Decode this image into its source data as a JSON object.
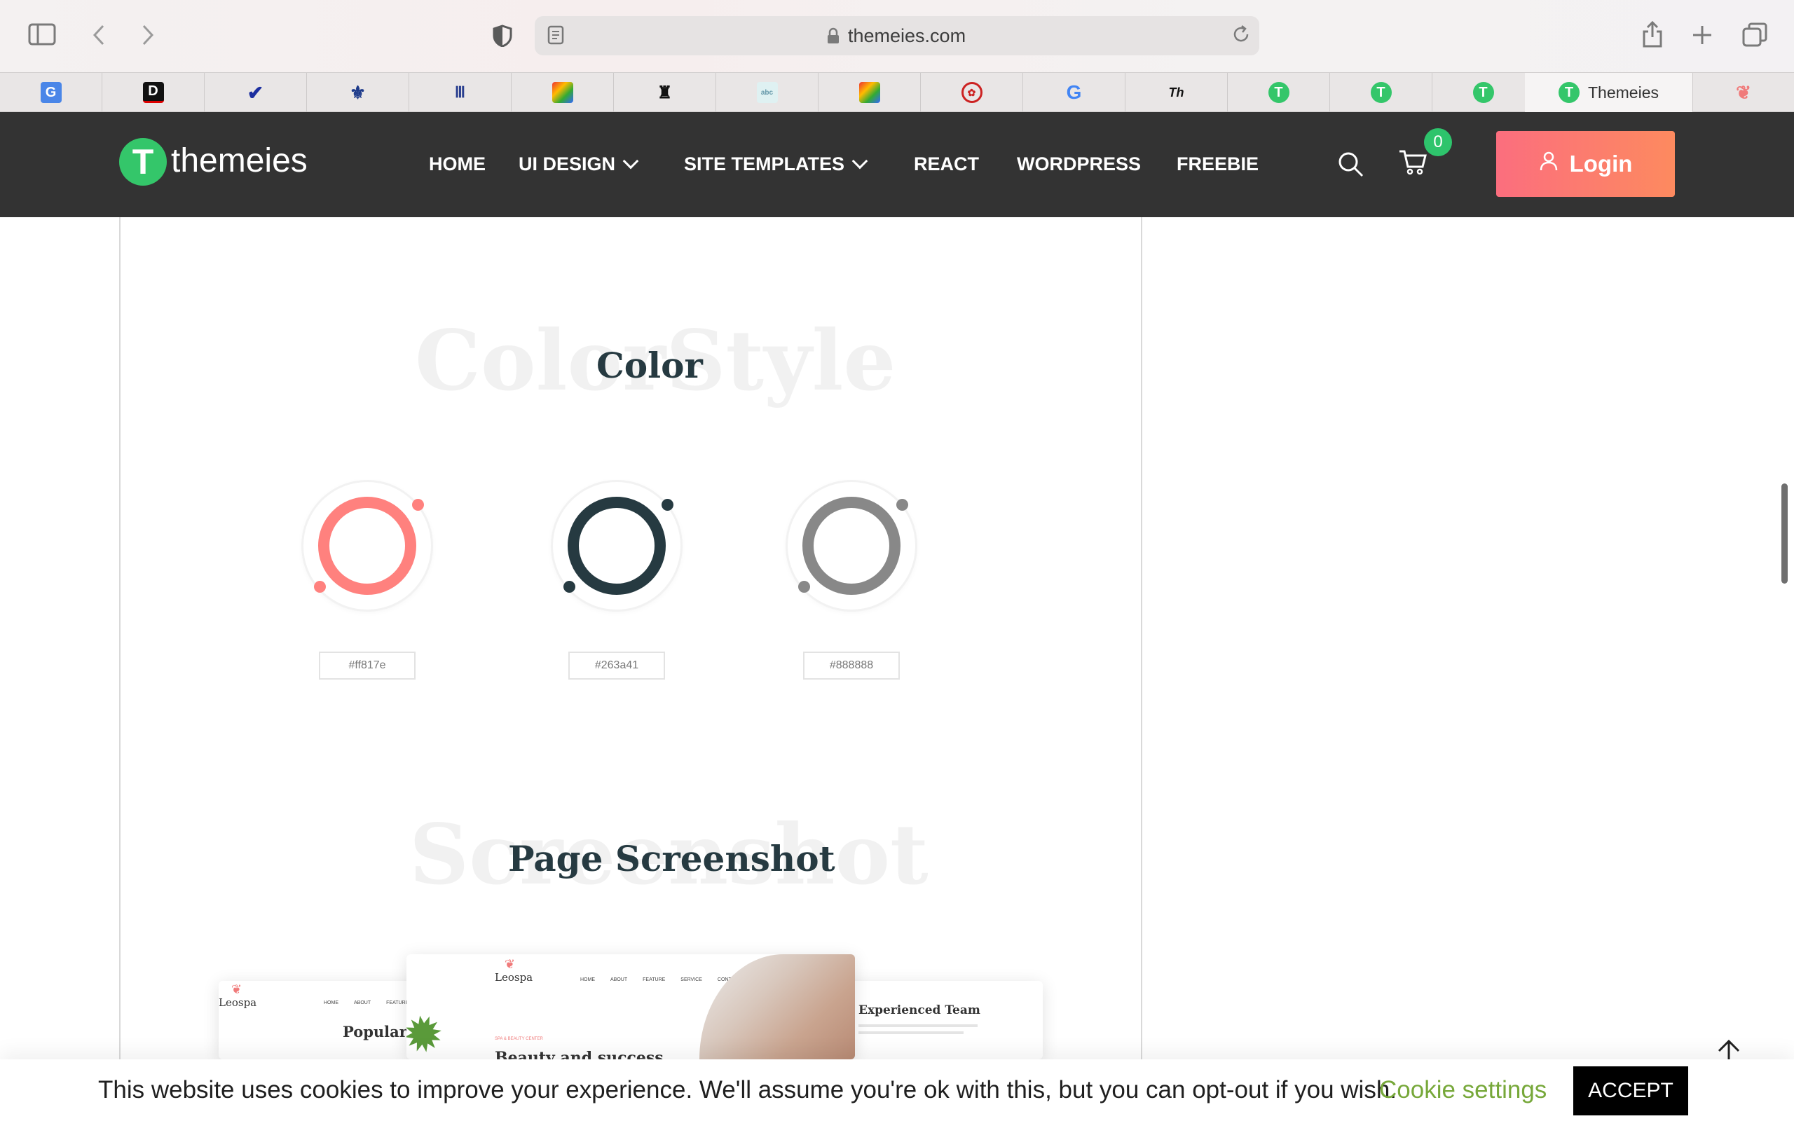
{
  "browser": {
    "url": "themeies.com",
    "active_tab_title": "Themeies",
    "tab_favicons": [
      "translate-icon",
      "dict-icon",
      "check-icon",
      "fleur-icon",
      "museum-icon",
      "grid-icon",
      "eagle-icon",
      "text-icon",
      "grid-icon",
      "seal-icon",
      "google-icon",
      "th-icon",
      "themeies-icon",
      "themeies-icon",
      "themeies-icon"
    ]
  },
  "site": {
    "logo_letter": "T",
    "logo_text": "themeies",
    "nav": {
      "home": "HOME",
      "ui_design": "UI DESIGN",
      "site_templates": "SITE TEMPLATES",
      "react": "REACT",
      "wordpress": "WORDPRESS",
      "freebie": "FREEBIE"
    },
    "cart_count": "0",
    "login_label": "Login",
    "accent_color": "#34c66a"
  },
  "color_section": {
    "bg_word": "ColorStyle",
    "title": "Color",
    "swatches": [
      {
        "hex": "#ff817e"
      },
      {
        "hex": "#263a41"
      },
      {
        "hex": "#888888"
      }
    ]
  },
  "screenshot_section": {
    "bg_word": "Screenshot",
    "title": "Page Screenshot",
    "preview_left": {
      "logo": "Leospa",
      "heading": "Popular F",
      "nav": [
        "HOME",
        "ABOUT",
        "FEATURE"
      ]
    },
    "preview_center": {
      "logo": "Leospa",
      "nav": [
        "HOME",
        "ABOUT",
        "FEATURE",
        "SERVICE",
        "CONTACT"
      ],
      "kicker": "SPA & BEAUTY CENTER",
      "heading": "Beauty and success"
    },
    "preview_right": {
      "heading": "Experienced Team"
    }
  },
  "cookie": {
    "message": "This website uses cookies to improve your experience. We'll assume you're ok with this, but you can opt-out if you wish.",
    "settings_label": "Cookie settings",
    "accept_label": "ACCEPT"
  }
}
